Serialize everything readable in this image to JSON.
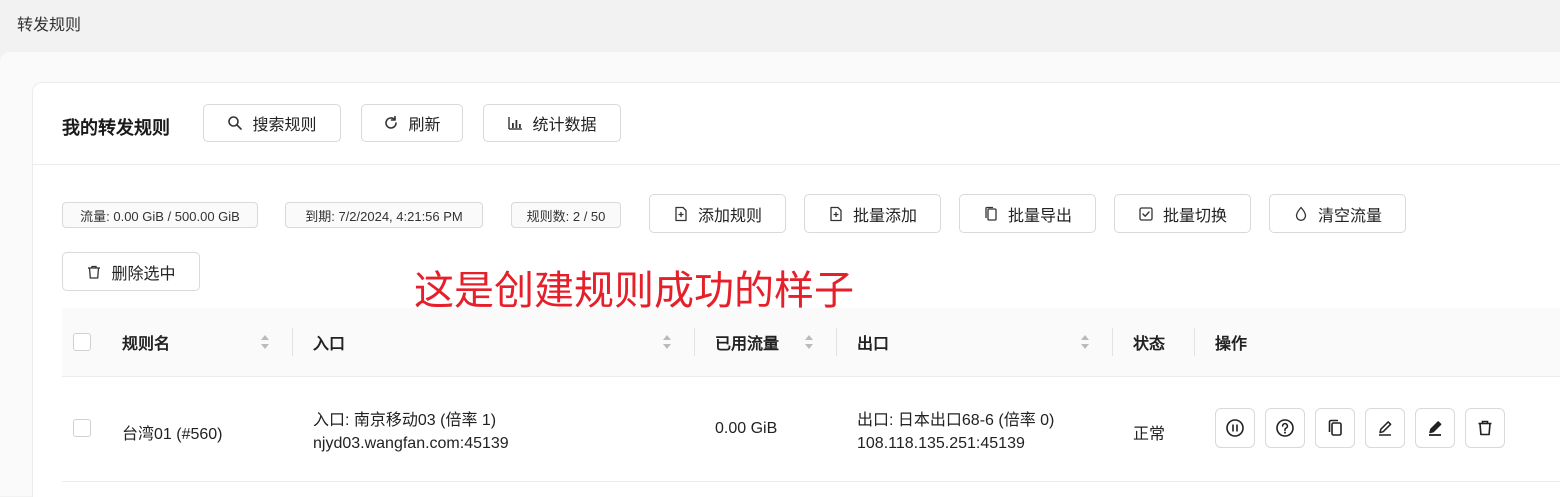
{
  "page": {
    "title": "转发规则"
  },
  "card": {
    "title": "我的转发规则",
    "header_buttons": [
      {
        "label": "搜索规则",
        "icon": "search-icon"
      },
      {
        "label": "刷新",
        "icon": "refresh-icon"
      },
      {
        "label": "统计数据",
        "icon": "bar-chart-icon"
      }
    ]
  },
  "stats": {
    "traffic": "流量: 0.00 GiB / 500.00 GiB",
    "expiry": "到期: 7/2/2024, 4:21:56 PM",
    "rule_count": "规则数: 2 / 50"
  },
  "toolbar": [
    {
      "label": "添加规则",
      "icon": "file-plus-icon"
    },
    {
      "label": "批量添加",
      "icon": "file-plus-icon"
    },
    {
      "label": "批量导出",
      "icon": "copy-icon"
    },
    {
      "label": "批量切换",
      "icon": "check-square-icon"
    },
    {
      "label": "清空流量",
      "icon": "drop-icon"
    },
    {
      "label": "删除选中",
      "icon": "trash-icon"
    }
  ],
  "annotation": "这是创建规则成功的样子",
  "table": {
    "columns": [
      "规则名",
      "入口",
      "已用流量",
      "出口",
      "状态",
      "操作"
    ],
    "rows": [
      {
        "name": "台湾01 (#560)",
        "entry_line1": "入口: 南京移动03 (倍率 1)",
        "entry_line2": "njyd03.wangfan.com:45139",
        "used": "0.00 GiB",
        "exit_line1": "出口: 日本出口68-6 (倍率 0)",
        "exit_line2": "108.118.135.251:45139",
        "status": "正常",
        "actions": [
          "pause-icon",
          "help-icon",
          "copy-icon",
          "edit-outline-icon",
          "edit-filled-icon",
          "trash-icon"
        ]
      }
    ]
  },
  "colors": {
    "annotation": "#e5202a",
    "border": "#d9d9d9"
  }
}
